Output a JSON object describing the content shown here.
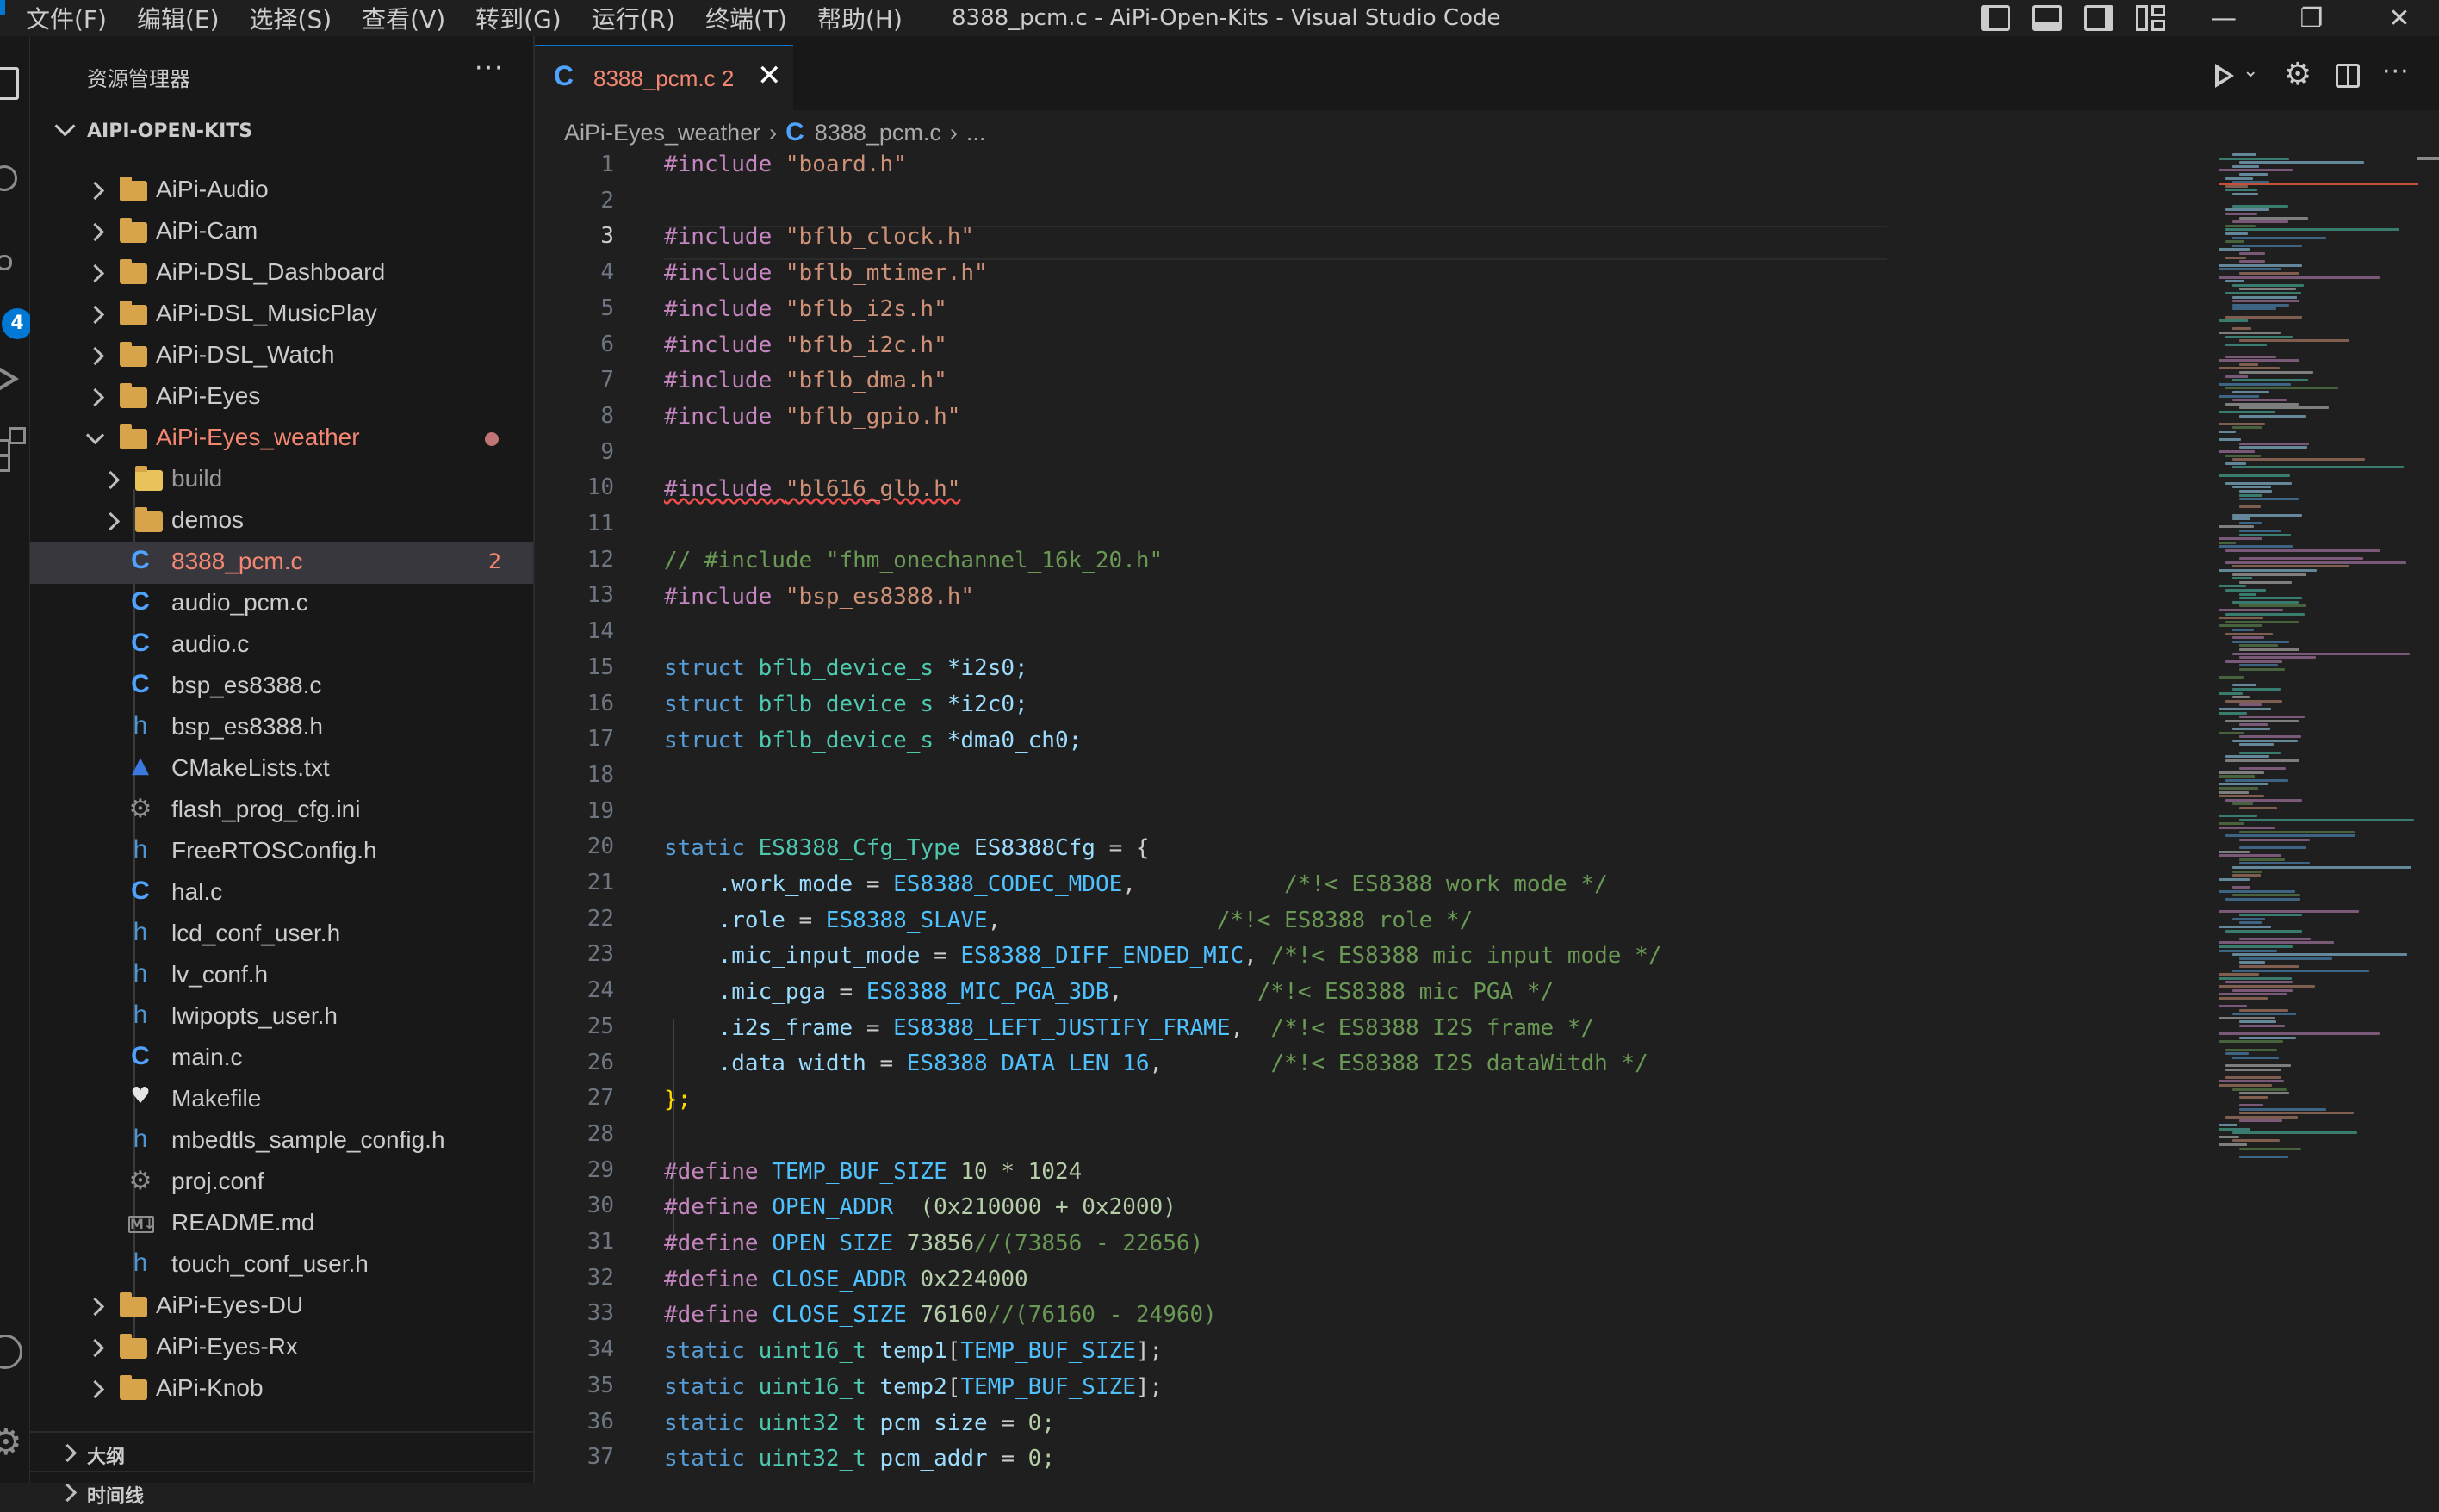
{
  "menu": [
    "文件(F)",
    "编辑(E)",
    "选择(S)",
    "查看(V)",
    "转到(G)",
    "运行(R)",
    "终端(T)",
    "帮助(H)"
  ],
  "window_title": "8388_pcm.c - AiPi-Open-Kits - Visual Studio Code",
  "window_buttons": {
    "minimize": "—",
    "restore": "❐",
    "close": "✕"
  },
  "activity_badge": "4",
  "sidebar": {
    "title": "资源管理器",
    "more": "···",
    "root": "AIPI-OPEN-KITS",
    "items": [
      {
        "label": "AiPi-Audio"
      },
      {
        "label": "AiPi-Cam"
      },
      {
        "label": "AiPi-DSL_Dashboard"
      },
      {
        "label": "AiPi-DSL_MusicPlay"
      },
      {
        "label": "AiPi-DSL_Watch"
      },
      {
        "label": "AiPi-Eyes"
      },
      {
        "label": "AiPi-Eyes_weather"
      },
      {
        "label": "build"
      },
      {
        "label": "demos"
      },
      {
        "label": "8388_pcm.c",
        "problems": "2"
      },
      {
        "label": "audio_pcm.c"
      },
      {
        "label": "audio.c"
      },
      {
        "label": "bsp_es8388.c"
      },
      {
        "label": "bsp_es8388.h"
      },
      {
        "label": "CMakeLists.txt"
      },
      {
        "label": "flash_prog_cfg.ini"
      },
      {
        "label": "FreeRTOSConfig.h"
      },
      {
        "label": "hal.c"
      },
      {
        "label": "lcd_conf_user.h"
      },
      {
        "label": "lv_conf.h"
      },
      {
        "label": "lwipopts_user.h"
      },
      {
        "label": "main.c"
      },
      {
        "label": "Makefile"
      },
      {
        "label": "mbedtls_sample_config.h"
      },
      {
        "label": "proj.conf"
      },
      {
        "label": "README.md"
      },
      {
        "label": "touch_conf_user.h"
      },
      {
        "label": "AiPi-Eyes-DU"
      },
      {
        "label": "AiPi-Eyes-Rx"
      },
      {
        "label": "AiPi-Knob"
      }
    ],
    "sections": [
      "大纲",
      "时间线"
    ]
  },
  "tab": {
    "icon": "C",
    "name": "8388_pcm.c",
    "problems": "2",
    "close": "✕"
  },
  "breadcrumb": {
    "folder": "AiPi-Eyes_weather",
    "file_icon": "C",
    "file": "8388_pcm.c",
    "more": "..."
  },
  "icons": {
    "c": "C",
    "h": "h",
    "gear": "⚙",
    "cmake": "▲",
    "makefile": "♥",
    "markdown": "M↓",
    "run": "▷",
    "chev": "⌄",
    "settings": "⚙",
    "split": "◫",
    "more": "···"
  },
  "code": {
    "line_numbers": [
      "1",
      "2",
      "3",
      "4",
      "5",
      "6",
      "7",
      "8",
      "9",
      "10",
      "11",
      "12",
      "13",
      "14",
      "15",
      "16",
      "17",
      "18",
      "19",
      "20",
      "21",
      "22",
      "23",
      "24",
      "25",
      "26",
      "27",
      "28",
      "29",
      "30",
      "31",
      "32",
      "33",
      "34",
      "35",
      "36",
      "37"
    ],
    "includes": {
      "kw": "#include",
      "l1": "\"board.h\"",
      "l3": "\"bflb_clock.h\"",
      "l4": "\"bflb_mtimer.h\"",
      "l5": "\"bflb_i2s.h\"",
      "l6": "\"bflb_i2c.h\"",
      "l7": "\"bflb_dma.h\"",
      "l8": "\"bflb_gpio.h\"",
      "l10": "\"bl616_glb.h\"",
      "l12": "// #include \"fhm_onechannel_16k_20.h\"",
      "l13": "\"bsp_es8388.h\""
    },
    "structs": [
      {
        "kw": "struct",
        "type": "bflb_device_s",
        "var": "*i2s0;"
      },
      {
        "kw": "struct",
        "type": "bflb_device_s",
        "var": "*i2c0;"
      },
      {
        "kw": "struct",
        "type": "bflb_device_s",
        "var": "*dma0_ch0;"
      }
    ],
    "cfg": {
      "static": "static",
      "type": "ES8388_Cfg_Type",
      "name": "ES8388Cfg",
      "open": " = {",
      "close": "};"
    },
    "cfg_fields": [
      {
        "field": ".work_mode",
        "value": "ES8388_CODEC_MDOE",
        "pad": ",           ",
        "comment": "/*!< ES8388 work mode */"
      },
      {
        "field": ".role",
        "value": "ES8388_SLAVE",
        "pad": ",                ",
        "comment": "/*!< ES8388 role */"
      },
      {
        "field": ".mic_input_mode",
        "value": "ES8388_DIFF_ENDED_MIC",
        "pad": ", ",
        "comment": "/*!< ES8388 mic input mode */"
      },
      {
        "field": ".mic_pga",
        "value": "ES8388_MIC_PGA_3DB",
        "pad": ",          ",
        "comment": "/*!< ES8388 mic PGA */"
      },
      {
        "field": ".i2s_frame",
        "value": "ES8388_LEFT_JUSTIFY_FRAME",
        "pad": ",  ",
        "comment": "/*!< ES8388 I2S frame */"
      },
      {
        "field": ".data_width",
        "value": "ES8388_DATA_LEN_16",
        "pad": ",        ",
        "comment": "/*!< ES8388 I2S dataWitdh */"
      }
    ],
    "defines": [
      {
        "kw": "#define",
        "name": "TEMP_BUF_SIZE",
        "value": "10 * 1024",
        "comment": ""
      },
      {
        "kw": "#define",
        "name": "OPEN_ADDR",
        "value": " (0x210000 + 0x2000)",
        "comment": ""
      },
      {
        "kw": "#define",
        "name": "OPEN_SIZE",
        "value": "73856",
        "comment": "//(73856 - 22656)"
      },
      {
        "kw": "#define",
        "name": "CLOSE_ADDR",
        "value": "0x224000",
        "comment": ""
      },
      {
        "kw": "#define",
        "name": "CLOSE_SIZE",
        "value": "76160",
        "comment": "//(76160 - 24960)"
      }
    ],
    "statics": [
      {
        "kw": "static",
        "type": "uint16_t",
        "name": "temp1",
        "rest": "[",
        "macro": "TEMP_BUF_SIZE",
        "end": "];"
      },
      {
        "kw": "static",
        "type": "uint16_t",
        "name": "temp2",
        "rest": "[",
        "macro": "TEMP_BUF_SIZE",
        "end": "];"
      },
      {
        "kw": "static",
        "type": "uint32_t",
        "name": "pcm_size",
        "rest": " = ",
        "macro": "",
        "end": "0;"
      },
      {
        "kw": "static",
        "type": "uint32_t",
        "name": "pcm_addr",
        "rest": " = ",
        "macro": "",
        "end": "0;"
      }
    ]
  },
  "colors": {
    "accent": "#0078d4",
    "modified": "#f48771",
    "keyword": "#c586c0",
    "string": "#ce9178",
    "type": "#4ec9b0",
    "comment": "#6a9955"
  }
}
